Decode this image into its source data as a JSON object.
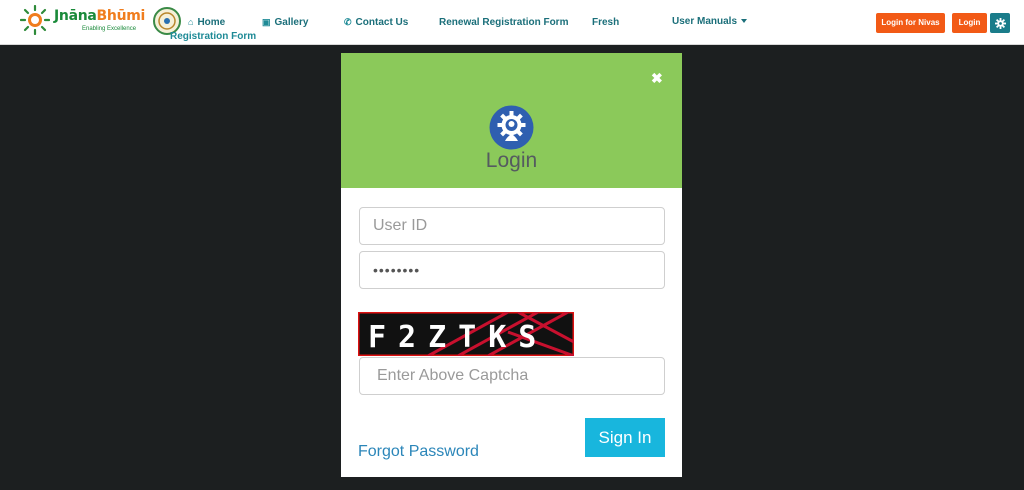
{
  "brand": {
    "name_main": "Jnāna",
    "name_accent": "Bhūmi",
    "tagline": "Enabling Excellence"
  },
  "nav": {
    "home": "Home",
    "registration_form": "Registration Form",
    "gallery": "Gallery",
    "contact": "Contact Us",
    "renewal": "Renewal Registration Form",
    "fresh": "Fresh",
    "manuals": "User Manuals"
  },
  "header_buttons": {
    "login_nivas": "Login for Nivas",
    "login": "Login"
  },
  "modal": {
    "title": "Login",
    "close": "✖",
    "user_placeholder": "User ID",
    "password_value": "••••••••",
    "captcha_text": "F2ZTKS",
    "captcha_placeholder": "Enter Above Captcha",
    "signin_label": "Sign In",
    "forgot_label": "Forgot Password"
  },
  "colors": {
    "header_green": "#8bc95a",
    "signin_blue": "#18b6dd",
    "nav_teal": "#1b6f7a",
    "login_orange": "#f25a16",
    "overlay": "#1c1f20"
  },
  "icons": [
    "home-icon",
    "image-icon",
    "phone-icon",
    "gear-icon",
    "close-icon",
    "login-gear-person-icon"
  ]
}
